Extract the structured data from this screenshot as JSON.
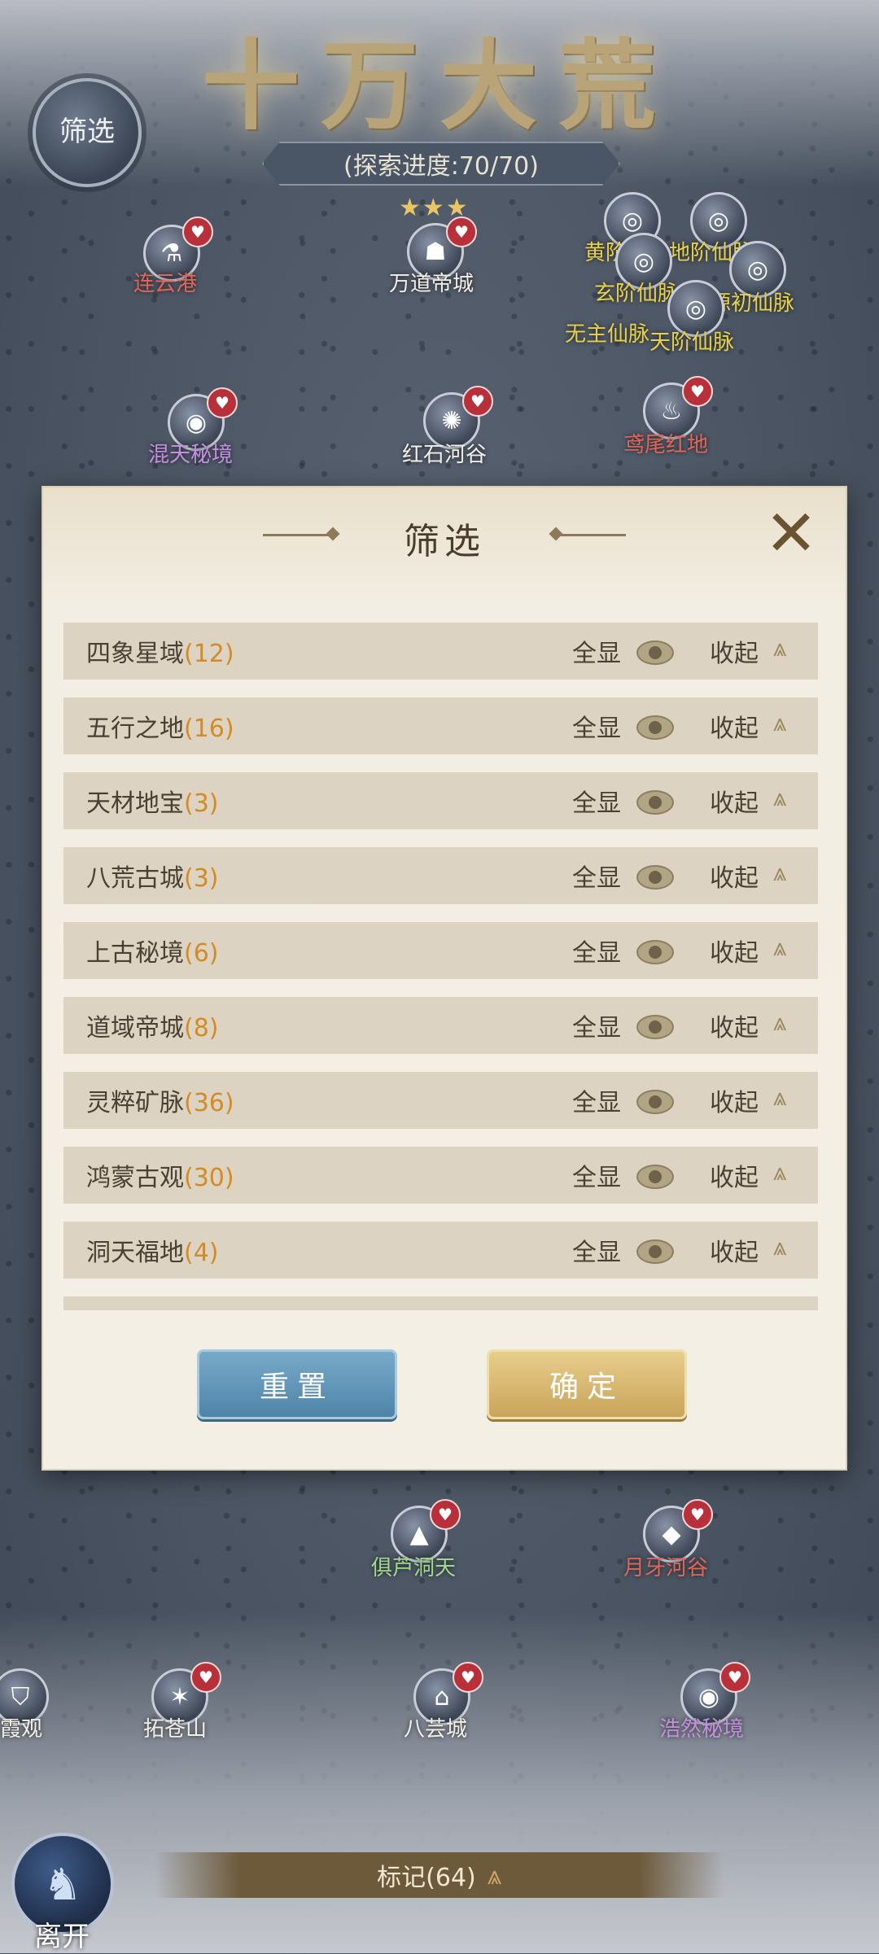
{
  "header": {
    "title_art": "十万大荒",
    "progress": "(探索进度:70/70)",
    "filter_badge": "筛选"
  },
  "map": {
    "locations": [
      {
        "id": "lianyungang",
        "label": "连云港",
        "color": "red"
      },
      {
        "id": "wandao",
        "label": "万道帝城",
        "color": "white"
      },
      {
        "id": "huangjie",
        "label": "黄阶仙脉",
        "color": "yellow"
      },
      {
        "id": "dijie",
        "label": "地阶仙脉",
        "color": "yellow"
      },
      {
        "id": "xuanjie",
        "label": "玄阶仙脉",
        "color": "yellow"
      },
      {
        "id": "yuanchu",
        "label": "源初仙脉",
        "color": "yellow"
      },
      {
        "id": "wuzhu",
        "label": "无主仙脉",
        "color": "yellow"
      },
      {
        "id": "tianjie",
        "label": "天阶仙脉",
        "color": "yellow"
      },
      {
        "id": "huntian",
        "label": "混天秘境",
        "color": "purple"
      },
      {
        "id": "hongshi",
        "label": "红石河谷",
        "color": "white"
      },
      {
        "id": "yuanwei",
        "label": "鸢尾红地",
        "color": "red"
      },
      {
        "id": "julu",
        "label": "俱芦洞天",
        "color": "green"
      },
      {
        "id": "yueya",
        "label": "月牙河谷",
        "color": "red"
      },
      {
        "id": "xiaguan",
        "label": "霞观",
        "color": "white"
      },
      {
        "id": "tuocang",
        "label": "拓苍山",
        "color": "white"
      },
      {
        "id": "bayun",
        "label": "八芸城",
        "color": "white"
      },
      {
        "id": "haoran",
        "label": "浩然秘境",
        "color": "purple"
      }
    ]
  },
  "modal": {
    "title": "筛选",
    "close_icon": "close-icon",
    "show_all_label": "全显",
    "collapse_label": "收起",
    "rows": [
      {
        "name": "四象星域",
        "count": "(12)"
      },
      {
        "name": "五行之地",
        "count": "(16)"
      },
      {
        "name": "天材地宝",
        "count": "(3)"
      },
      {
        "name": "八荒古城",
        "count": "(3)"
      },
      {
        "name": "上古秘境",
        "count": "(6)"
      },
      {
        "name": "道域帝城",
        "count": "(8)"
      },
      {
        "name": "灵粹矿脉",
        "count": "(36)"
      },
      {
        "name": "鸿蒙古观",
        "count": "(30)"
      },
      {
        "name": "洞天福地",
        "count": "(4)"
      }
    ],
    "reset_label": "重置",
    "confirm_label": "确定"
  },
  "footer": {
    "leave_label": "离开",
    "mark_label": "标记(64)"
  }
}
